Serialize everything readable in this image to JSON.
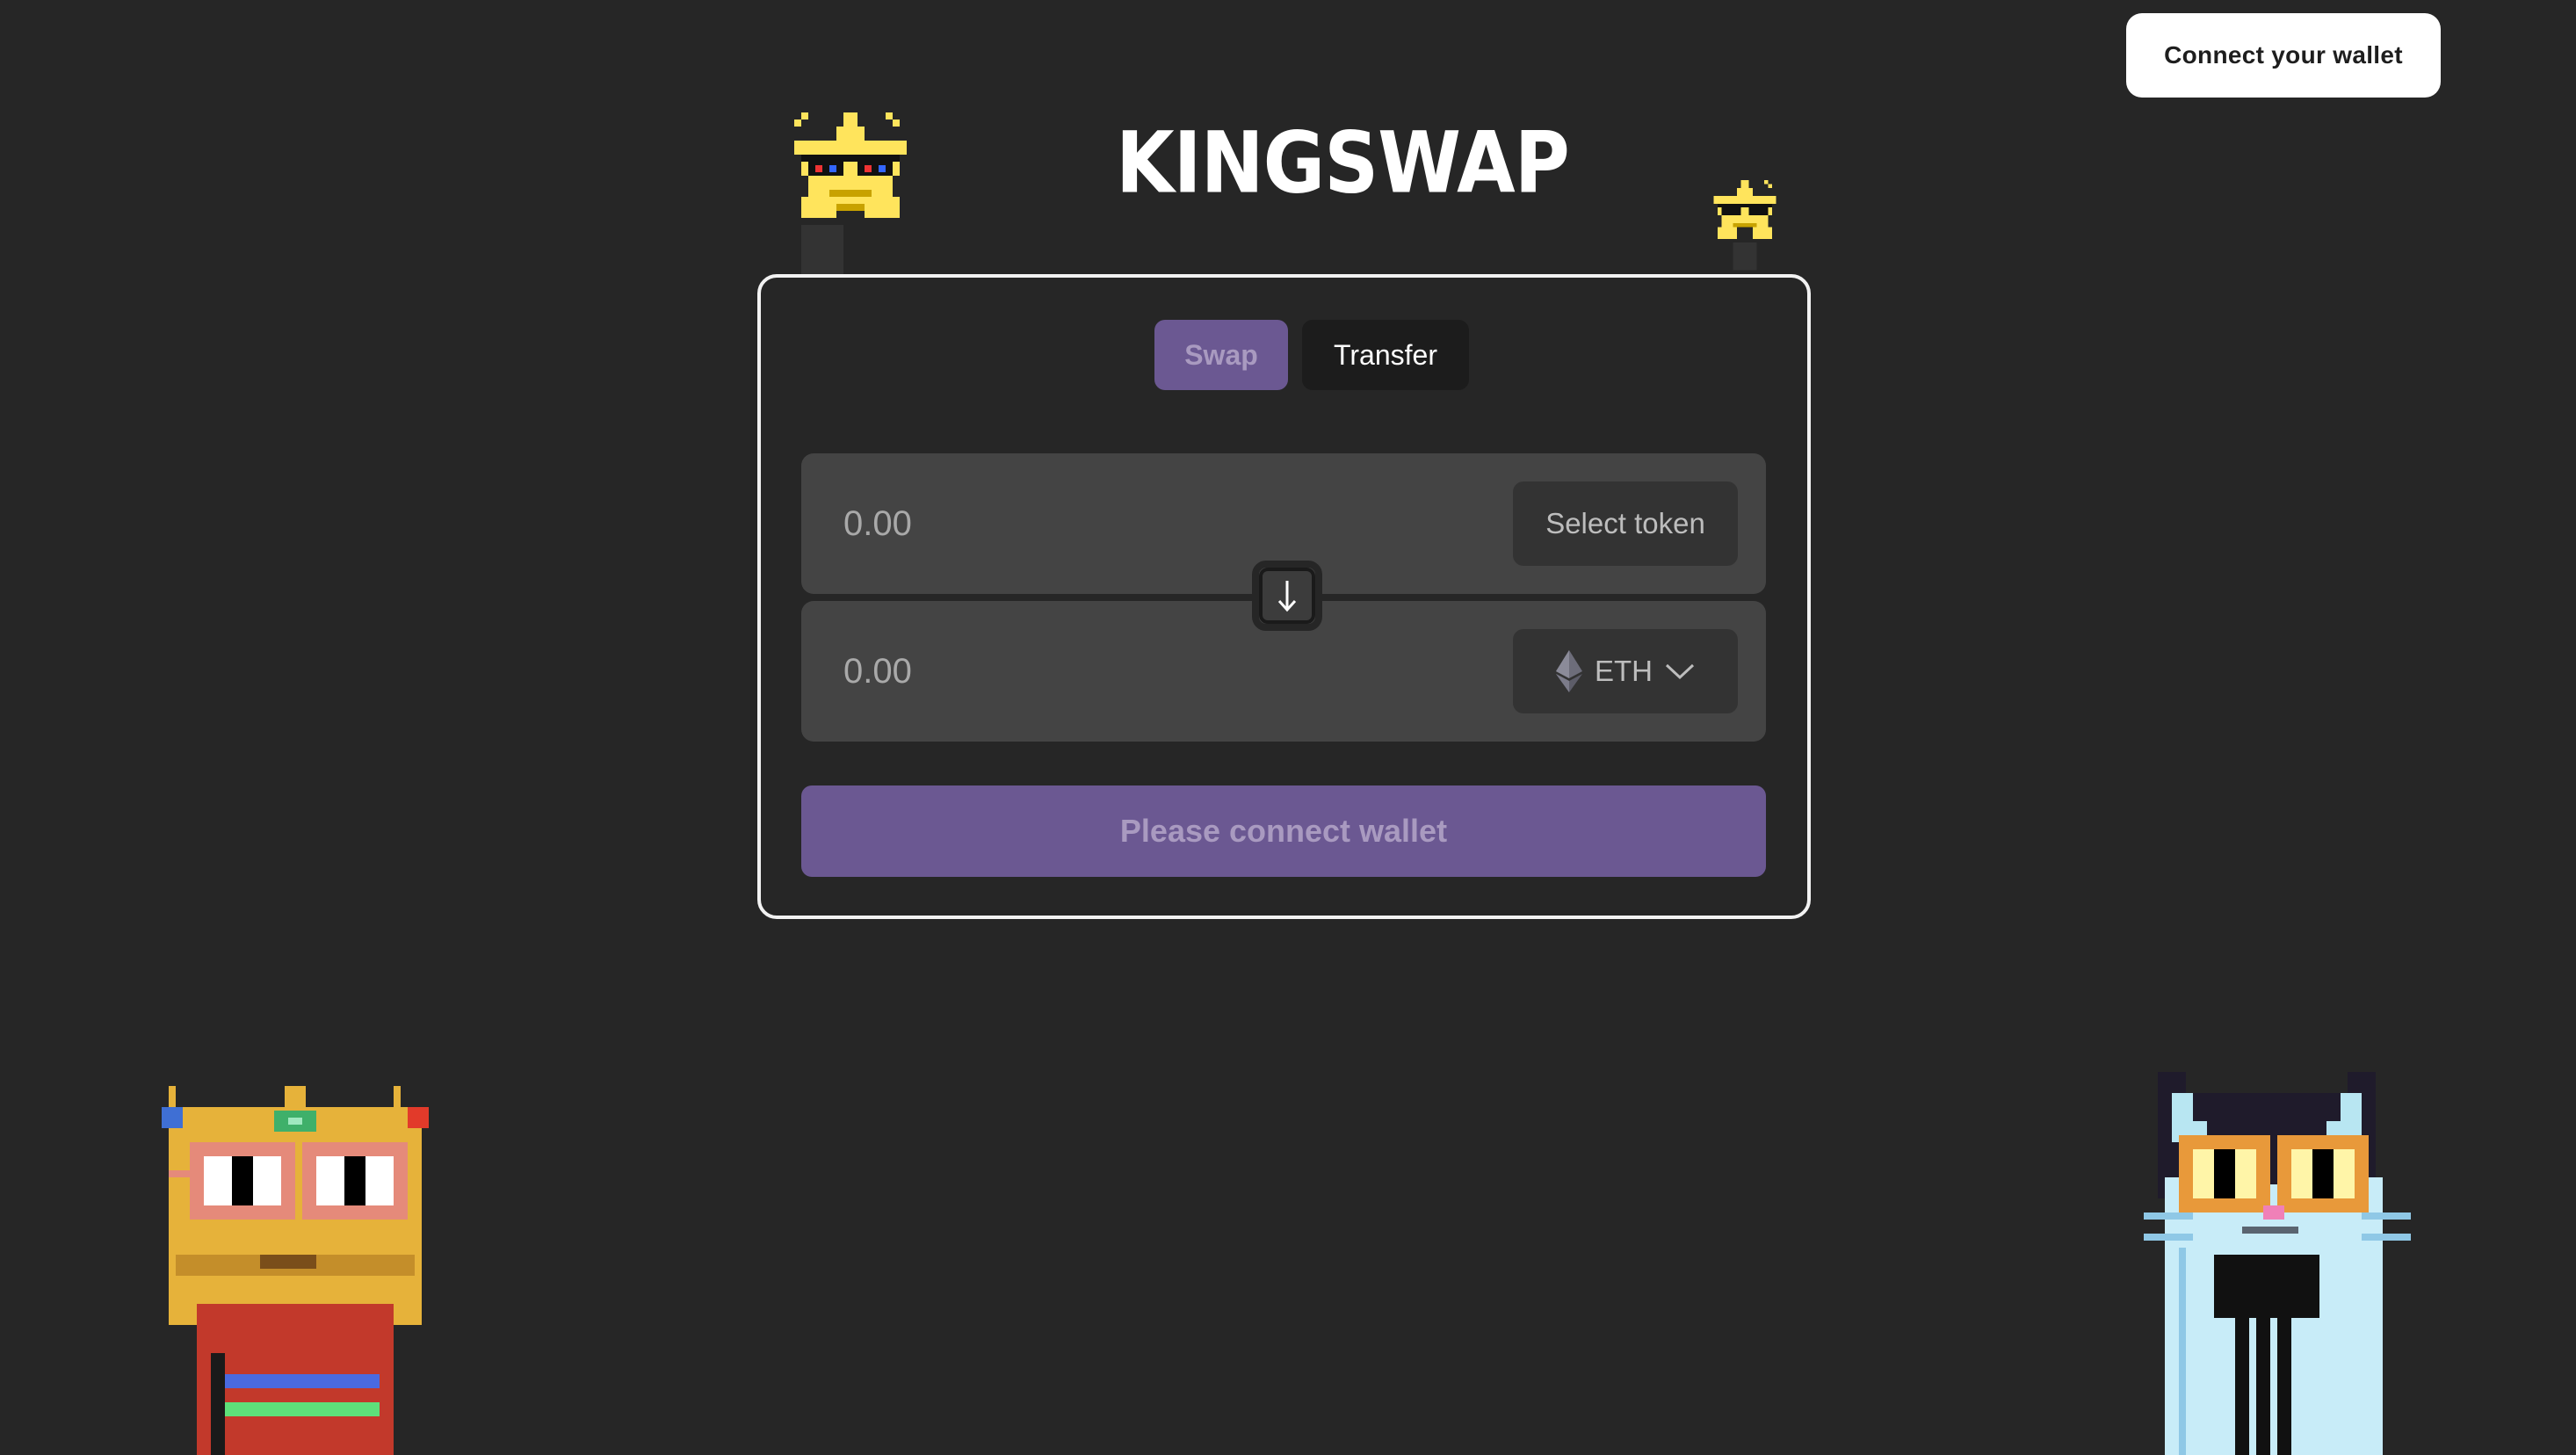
{
  "header": {
    "connect_label": "Connect your wallet"
  },
  "logo": {
    "text": "KINGSWAP"
  },
  "tabs": [
    {
      "label": "Swap",
      "active": true
    },
    {
      "label": "Transfer",
      "active": false
    }
  ],
  "swap": {
    "from": {
      "amount_placeholder": "0.00",
      "token_label": "Select token"
    },
    "to": {
      "amount_placeholder": "0.00",
      "token_label": "ETH",
      "token_icon": "ethereum-icon"
    },
    "switch_icon": "arrow-down-icon",
    "submit_label": "Please connect wallet"
  },
  "decorations": [
    {
      "name": "star-sunglasses-large",
      "icon": "pixel-star-sunglasses"
    },
    {
      "name": "star-sunglasses-small",
      "icon": "pixel-star-sunglasses"
    },
    {
      "name": "crowned-king-character",
      "icon": "pixel-king-crown-glasses"
    },
    {
      "name": "cat-character",
      "icon": "pixel-cat-glasses"
    }
  ],
  "colors": {
    "background": "#262626",
    "accent_purple": "#6b5892",
    "card_border": "#f2f2f2",
    "field_bg": "#444444"
  }
}
